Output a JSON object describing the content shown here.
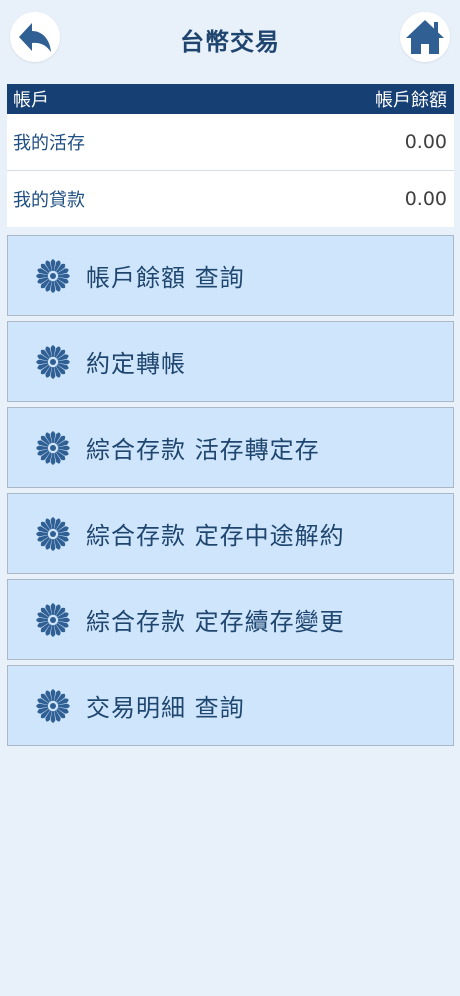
{
  "header": {
    "title": "台幣交易",
    "back_icon": "back-arrow-icon",
    "home_icon": "home-icon"
  },
  "accounts": {
    "header_left": "帳戶",
    "header_right": "帳戶餘額",
    "rows": [
      {
        "name": "我的活存",
        "balance": "0.00"
      },
      {
        "name": "我的貸款",
        "balance": "0.00"
      }
    ]
  },
  "menu": {
    "icon": "chrysanthemum-logo-icon",
    "items": [
      {
        "label": "帳戶餘額  查詢"
      },
      {
        "label": "約定轉帳"
      },
      {
        "label": "綜合存款  活存轉定存"
      },
      {
        "label": "綜合存款  定存中途解約"
      },
      {
        "label": "綜合存款  定存續存變更"
      },
      {
        "label": "交易明細  查詢"
      }
    ]
  },
  "colors": {
    "background": "#e8f0fa",
    "header_bar": "#163f74",
    "menu_item": "#cfe5fc",
    "text_primary": "#1f466f",
    "icon": "#2f5f93"
  }
}
